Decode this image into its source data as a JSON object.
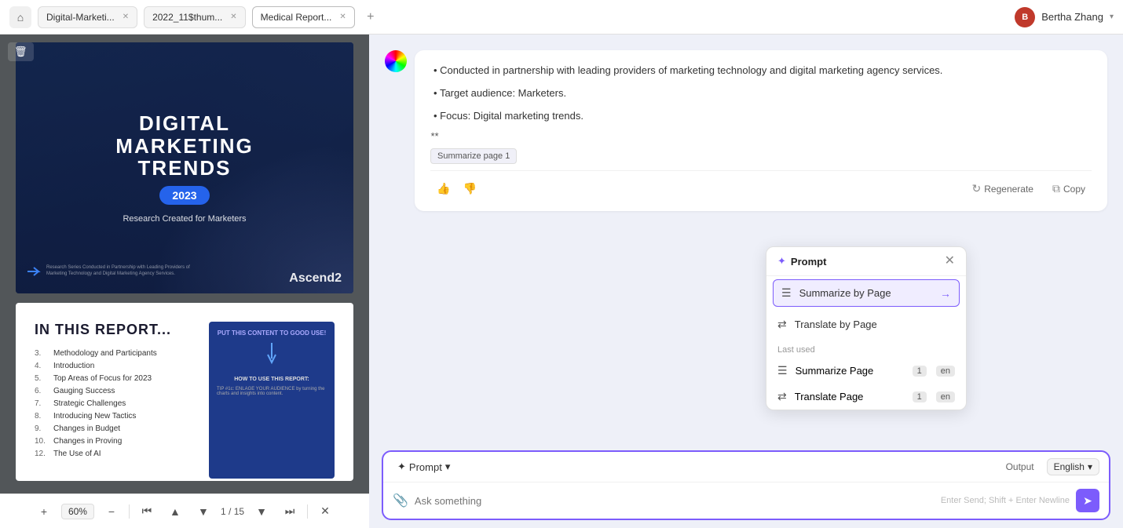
{
  "topbar": {
    "home_icon": "⌂",
    "tabs": [
      {
        "label": "Digital-Marketi...",
        "active": false,
        "closable": true
      },
      {
        "label": "2022_11$thum...",
        "active": false,
        "closable": true
      },
      {
        "label": "Medical Report...",
        "active": true,
        "closable": true
      }
    ],
    "add_tab_icon": "+",
    "user": {
      "avatar_initials": "B",
      "name": "Bertha Zhang",
      "chevron": "▾"
    }
  },
  "pdf": {
    "delete_icon": "🗑",
    "cover": {
      "title_line1": "DIGITAL",
      "title_line2": "MARKETING",
      "title_line3": "TRENDS",
      "year": "2023",
      "subtitle": "Research Created for Marketers",
      "ascend_brand": "Ascend2",
      "small_text": "Research Series Conducted in Partnership with Leading Providers of Marketing Technology and Digital Marketing Agency Services."
    },
    "page2": {
      "title": "IN THIS REPORT...",
      "toc_items": [
        {
          "num": "3.",
          "label": "Methodology and Participants"
        },
        {
          "num": "4.",
          "label": "Introduction"
        },
        {
          "num": "5.",
          "label": "Top Areas of Focus for 2023"
        },
        {
          "num": "6.",
          "label": "Gauging Success"
        },
        {
          "num": "7.",
          "label": "Strategic Challenges"
        },
        {
          "num": "8.",
          "label": "Introducing New Tactics"
        },
        {
          "num": "9.",
          "label": "Changes in Budget"
        },
        {
          "num": "10.",
          "label": "Changes in Proving"
        },
        {
          "num": "12.",
          "label": "The Use of AI"
        }
      ]
    },
    "toolbar": {
      "zoom_add": "+",
      "zoom_level": "60%",
      "zoom_remove": "-",
      "sep1": "|",
      "nav_first": "⏮",
      "nav_prev": "▲",
      "nav_next": "▼",
      "page_current": "1",
      "page_sep": "/",
      "page_total": "15",
      "nav_down": "▼",
      "nav_end": "⏭",
      "sep2": "|",
      "close": "✕"
    }
  },
  "chat": {
    "messages": [
      {
        "bullets": [
          "Conducted in partnership with leading providers of marketing technology and digital marketing agency services.",
          "Target audience: Marketers.",
          "Focus: Digital marketing trends."
        ],
        "italic": "**",
        "tag": "Summarize page 1",
        "actions": {
          "thumbup": "👍",
          "thumbdown": "👎",
          "regenerate_label": "Regenerate",
          "copy_label": "Copy",
          "copy_icon": "⧉",
          "regenerate_icon": "↻"
        }
      }
    ]
  },
  "prompt_dropdown": {
    "title": "Prompt",
    "sparkle": "✦",
    "close": "✕",
    "items": [
      {
        "icon": "☰",
        "label": "Summarize by Page",
        "selected": true,
        "arrow": "→"
      },
      {
        "icon": "⇄",
        "label": "Translate by Page",
        "selected": false
      }
    ],
    "last_used_label": "Last used",
    "last_used_items": [
      {
        "icon": "☰",
        "label": "Summarize Page",
        "num": "1",
        "lang": "en"
      },
      {
        "icon": "⇄",
        "label": "Translate Page",
        "num": "1",
        "lang": "en"
      }
    ]
  },
  "bottom_input": {
    "prompt_sparkle": "✦",
    "prompt_label": "Prompt",
    "prompt_chevron": "▾",
    "output_label": "Output",
    "language": "English",
    "language_chevron": "▾",
    "attach_icon": "📎",
    "placeholder": "Ask something",
    "hint": "Enter Send; Shift + Enter Newline",
    "send_icon": "➤"
  }
}
